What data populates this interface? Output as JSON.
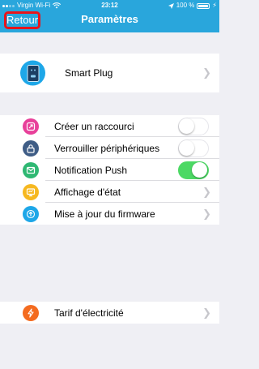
{
  "status_bar": {
    "carrier": "Virgin Wi-Fi",
    "time": "23:12",
    "battery": "100 %"
  },
  "nav": {
    "back_label": "Retour",
    "title": "Paramètres"
  },
  "device": {
    "label": "Smart Plug"
  },
  "settings": [
    {
      "label": "Créer un raccourci",
      "control": "toggle",
      "on": false,
      "icon": "share-icon",
      "color": "#e8409a"
    },
    {
      "label": "Verrouiller périphériques",
      "control": "toggle",
      "on": false,
      "icon": "lock-icon",
      "color": "#3f5d86"
    },
    {
      "label": "Notification Push",
      "control": "toggle",
      "on": true,
      "icon": "mail-icon",
      "color": "#2fb873"
    },
    {
      "label": "Affichage d'état",
      "control": "chevron",
      "icon": "display-icon",
      "color": "#f6b820"
    },
    {
      "label": "Mise à jour du firmware",
      "control": "chevron",
      "icon": "upload-icon",
      "color": "#1ea7e8"
    }
  ],
  "tariff": {
    "label": "Tarif d'électricité",
    "icon": "lightning-icon",
    "color": "#f46b1f"
  },
  "colors": {
    "header": "#29a6dc",
    "background": "#efeff4",
    "highlight": "#e8141b",
    "toggle_on": "#4cd964"
  }
}
